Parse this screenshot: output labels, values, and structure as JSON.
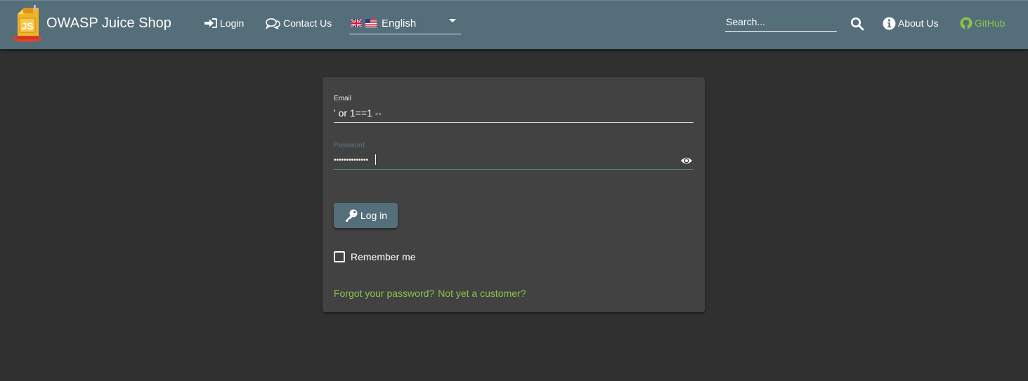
{
  "app": {
    "title": "OWASP Juice Shop",
    "logo_icon": "juice-box-logo-icon"
  },
  "navbar": {
    "login_label": "Login",
    "login_icon": "sign-in-icon",
    "contact_label": "Contact Us",
    "contact_icon": "comments-icon",
    "language": {
      "selected": "English",
      "flags": [
        "uk-flag-icon",
        "us-flag-icon"
      ]
    },
    "search": {
      "placeholder": "Search...",
      "value": "",
      "icon": "search-icon"
    },
    "about_label": "About Us",
    "about_icon": "info-circle-icon",
    "github_label": "GitHub",
    "github_icon": "github-icon"
  },
  "login_form": {
    "email_label": "Email",
    "email_value": "' or 1==1 --",
    "password_label": "Password",
    "password_masked": "••••••••••••••",
    "show_password_icon": "eye-icon",
    "submit_label": "Log in",
    "submit_icon": "key-icon",
    "remember_label": "Remember me",
    "remember_checked": false,
    "forgot_link": "Forgot your password?",
    "register_link": "Not yet a customer?"
  },
  "colors": {
    "navbar": "#546e7a",
    "background": "#303030",
    "card": "#424242",
    "link": "#8bc34a",
    "button": "#546e7a"
  }
}
